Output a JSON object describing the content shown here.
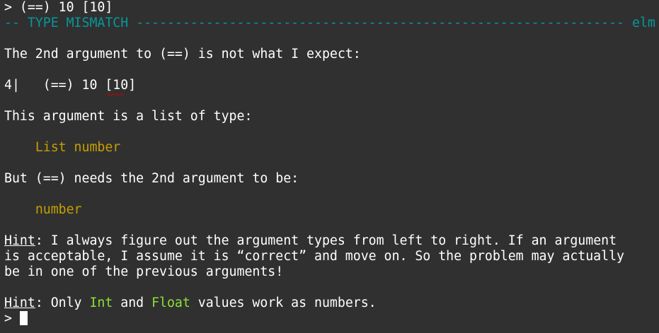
{
  "input_line": "> (==) 10 [10]",
  "header": {
    "title": "-- TYPE MISMATCH ---------------------------------------------------------------",
    "tag": "elm"
  },
  "message": {
    "intro": "The 2nd argument to (==) is not what I expect:",
    "code_line_number": "4|",
    "code_before": "   (==) 10 ",
    "code_highlight": "[10]",
    "squiggle": "^^^^",
    "arg_desc": "This argument is a list of type:",
    "actual_type": "List number",
    "expect_desc": "But (==) needs the 2nd argument to be:",
    "expected_type": "number"
  },
  "hint1": {
    "label": "Hint",
    "line1": ": I always figure out the argument types from left to right. If an argument",
    "line2": "is acceptable, I assume it is “correct” and move on. So the problem may actually",
    "line3": "be in one of the previous arguments!"
  },
  "hint2": {
    "label": "Hint",
    "text_a": ": Only ",
    "type_int": "Int",
    "text_b": " and ",
    "type_float": "Float",
    "text_c": " values work as numbers."
  },
  "prompt": "> "
}
